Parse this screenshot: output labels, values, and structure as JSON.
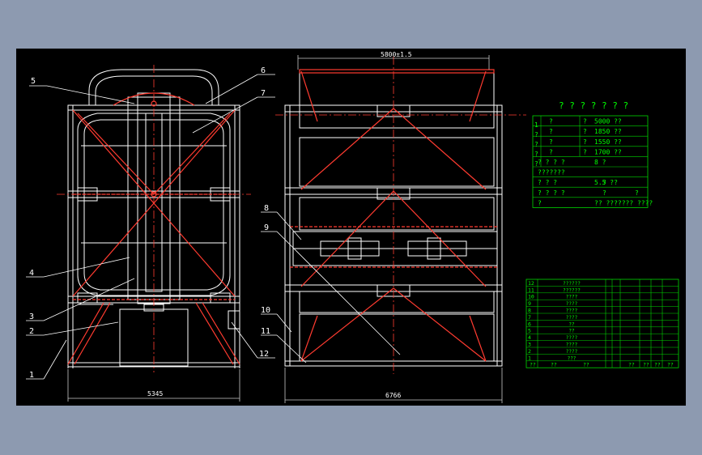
{
  "colors": {
    "background": "#8d9ab0",
    "canvas": "#000000",
    "structure": "#ffffff",
    "members": "#ff3b30",
    "dimension": "#c8c8c8",
    "table_line": "#00d800",
    "text": "#ffffff",
    "annotation_text": "#00ff00",
    "leader": "#ffffff"
  },
  "front_view": {
    "width_dimension": "5345",
    "callouts": [
      "1",
      "2",
      "3",
      "4",
      "5",
      "6",
      "7",
      "12"
    ]
  },
  "side_view": {
    "width_dimension": "6766",
    "top_dimension": "5800±1.5",
    "callouts": [
      "8",
      "9",
      "10",
      "11"
    ]
  },
  "spec_table": {
    "heading": "? ? ? ? ? ? ?",
    "rows": [
      {
        "label": "?",
        "key": "?",
        "value": "5000 ??"
      },
      {
        "label": "?",
        "key": "?",
        "value": "1850 ??"
      },
      {
        "label": "?",
        "key": "?",
        "value": "1550 ??"
      },
      {
        "label": "?",
        "key": "?",
        "value": "1700 ??"
      },
      {
        "label": "? ? ? ?",
        "key": "",
        "value": "8 ?"
      },
      {
        "label": "???????",
        "key": "",
        "value": ""
      },
      {
        "label": "? ? ?",
        "key": "?",
        "value": "5.5 ??"
      },
      {
        "label": "? ? ? ?",
        "key": "?",
        "value": "?"
      },
      {
        "label": "?",
        "key": "",
        "value": "?? ??????? ????"
      }
    ],
    "side_marks": [
      "1",
      "?",
      "?",
      "?",
      "?"
    ]
  },
  "parts_list": {
    "rows": [
      {
        "no": "12",
        "name": "??????"
      },
      {
        "no": "11",
        "name": "??????"
      },
      {
        "no": "10",
        "name": "????"
      },
      {
        "no": "9",
        "name": "????"
      },
      {
        "no": "8",
        "name": "????"
      },
      {
        "no": "7",
        "name": "????"
      },
      {
        "no": "6",
        "name": "??"
      },
      {
        "no": "5",
        "name": "??"
      },
      {
        "no": "4",
        "name": "????"
      },
      {
        "no": "3",
        "name": "????"
      },
      {
        "no": "2",
        "name": "????"
      },
      {
        "no": "1",
        "name": "???"
      }
    ],
    "footer": [
      "??",
      "??",
      "??",
      "??",
      "??",
      "??",
      "??"
    ]
  }
}
